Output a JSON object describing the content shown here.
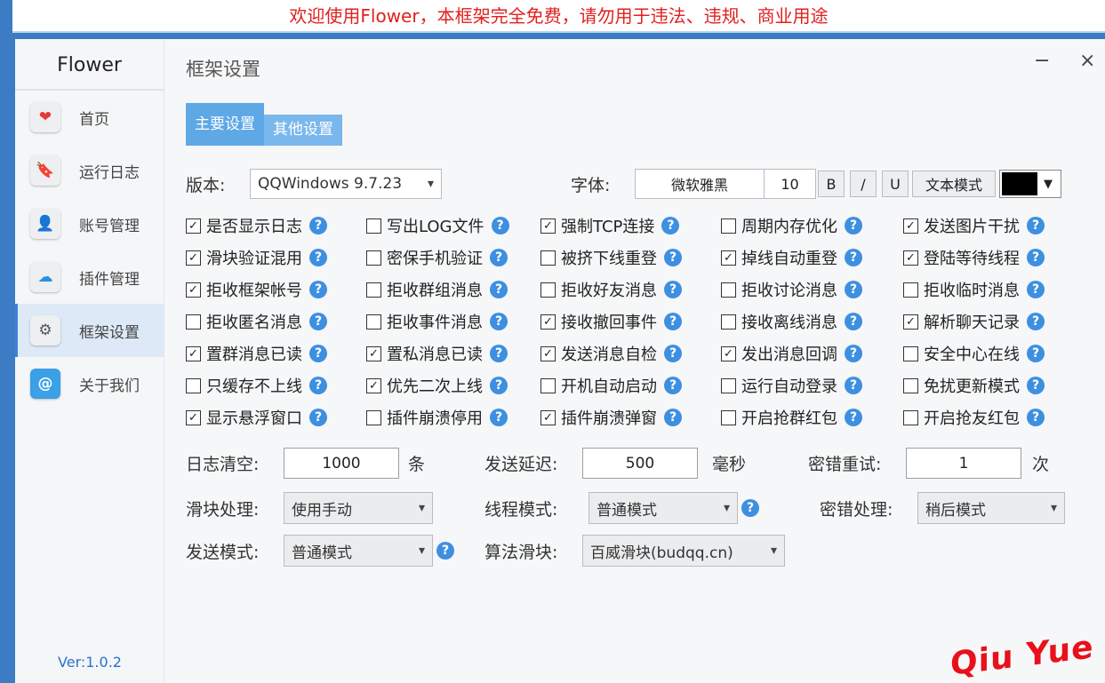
{
  "banner": "欢迎使用Flower，本框架完全免费，请勿用于违法、违规、商业用途",
  "app_name": "Flower",
  "version": "Ver:1.0.2",
  "nav": [
    {
      "label": "首页",
      "icon": "heart-icon",
      "glyph": "❤",
      "color": "#e53935"
    },
    {
      "label": "运行日志",
      "icon": "bookmark-icon",
      "glyph": "🔖",
      "color": "#8e3fd1"
    },
    {
      "label": "账号管理",
      "icon": "user-icon",
      "glyph": "👤",
      "color": "#222222"
    },
    {
      "label": "插件管理",
      "icon": "cloud-icon",
      "glyph": "☁",
      "color": "#2b8fe0"
    },
    {
      "label": "框架设置",
      "icon": "gear-icon",
      "glyph": "⚙",
      "color": "#555555"
    },
    {
      "label": "关于我们",
      "icon": "at-icon",
      "glyph": "@",
      "color": "#ffffff"
    }
  ],
  "active_nav": 4,
  "page_title": "框架设置",
  "window": {
    "minimize": "−",
    "close": "×"
  },
  "tabs": [
    {
      "label": "主要设置",
      "active": true
    },
    {
      "label": "其他设置",
      "active": false
    }
  ],
  "version_label": "版本:",
  "version_value": "QQWindows 9.7.23",
  "font_label": "字体:",
  "font_name": "微软雅黑",
  "font_size": "10",
  "bold_btn": "B",
  "italic_btn": "/",
  "underline_btn": "U",
  "text_mode_btn": "文本模式",
  "color_swatch": "#000000",
  "checkboxes": [
    {
      "label": "是否显示日志",
      "checked": true
    },
    {
      "label": "写出LOG文件",
      "checked": false
    },
    {
      "label": "强制TCP连接",
      "checked": true
    },
    {
      "label": "周期内存优化",
      "checked": false
    },
    {
      "label": "发送图片干扰",
      "checked": true
    },
    {
      "label": "滑块验证混用",
      "checked": true
    },
    {
      "label": "密保手机验证",
      "checked": false
    },
    {
      "label": "被挤下线重登",
      "checked": false
    },
    {
      "label": "掉线自动重登",
      "checked": true
    },
    {
      "label": "登陆等待线程",
      "checked": true
    },
    {
      "label": "拒收框架帐号",
      "checked": true
    },
    {
      "label": "拒收群组消息",
      "checked": false
    },
    {
      "label": "拒收好友消息",
      "checked": false
    },
    {
      "label": "拒收讨论消息",
      "checked": false
    },
    {
      "label": "拒收临时消息",
      "checked": false
    },
    {
      "label": "拒收匿名消息",
      "checked": false
    },
    {
      "label": "拒收事件消息",
      "checked": false
    },
    {
      "label": "接收撤回事件",
      "checked": true
    },
    {
      "label": "接收离线消息",
      "checked": false
    },
    {
      "label": "解析聊天记录",
      "checked": true
    },
    {
      "label": "置群消息已读",
      "checked": true
    },
    {
      "label": "置私消息已读",
      "checked": true
    },
    {
      "label": "发送消息自检",
      "checked": true
    },
    {
      "label": "发出消息回调",
      "checked": true
    },
    {
      "label": "安全中心在线",
      "checked": false
    },
    {
      "label": "只缓存不上线",
      "checked": false
    },
    {
      "label": "优先二次上线",
      "checked": true
    },
    {
      "label": "开机自动启动",
      "checked": false
    },
    {
      "label": "运行自动登录",
      "checked": false
    },
    {
      "label": "免扰更新模式",
      "checked": false
    },
    {
      "label": "显示悬浮窗口",
      "checked": true
    },
    {
      "label": "插件崩溃停用",
      "checked": false
    },
    {
      "label": "插件崩溃弹窗",
      "checked": true
    },
    {
      "label": "开启抢群红包",
      "checked": false
    },
    {
      "label": "开启抢友红包",
      "checked": false
    }
  ],
  "log_clear_label": "日志清空:",
  "log_clear_value": "1000",
  "log_clear_unit": "条",
  "send_delay_label": "发送延迟:",
  "send_delay_value": "500",
  "send_delay_unit": "毫秒",
  "pwd_retry_label": "密错重试:",
  "pwd_retry_value": "1",
  "pwd_retry_unit": "次",
  "slider_label": "滑块处理:",
  "slider_value": "使用手动",
  "thread_label": "线程模式:",
  "thread_value": "普通模式",
  "pwd_handle_label": "密错处理:",
  "pwd_handle_value": "稍后模式",
  "send_mode_label": "发送模式:",
  "send_mode_value": "普通模式",
  "algo_label": "算法滑块:",
  "algo_value": "百威滑块(budqq.cn)",
  "help_glyph": "?",
  "watermark": "Qiu  Yue"
}
